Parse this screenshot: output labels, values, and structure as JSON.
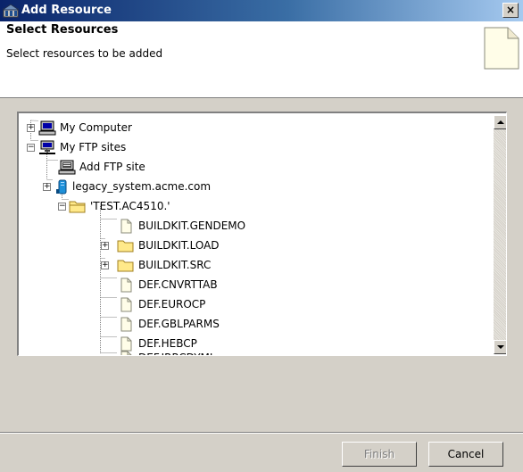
{
  "window": {
    "title": "Add Resource",
    "close_label": "×"
  },
  "header": {
    "title": "Select Resources",
    "description": "Select resources to be added"
  },
  "tree": {
    "items": [
      {
        "label": "My Computer",
        "icon": "computer-icon",
        "expander": "+"
      },
      {
        "label": "My FTP sites",
        "icon": "network-computer-icon",
        "expander": "−"
      },
      {
        "label": "Add FTP site",
        "icon": "add-ftp-site-icon"
      },
      {
        "label": "legacy_system.acme.com",
        "icon": "server-icon",
        "expander": "+"
      },
      {
        "label": "'TEST.AC4510.'",
        "icon": "folder-open-icon",
        "expander": "−"
      },
      {
        "label": "BUILDKIT.GENDEMO",
        "icon": "file-icon"
      },
      {
        "label": "BUILDKIT.LOAD",
        "icon": "folder-icon",
        "expander": "+"
      },
      {
        "label": "BUILDKIT.SRC",
        "icon": "folder-icon",
        "expander": "+"
      },
      {
        "label": "DEF.CNVRTTAB",
        "icon": "file-icon"
      },
      {
        "label": "DEF.EUROCP",
        "icon": "file-icon"
      },
      {
        "label": "DEF.GBLPARMS",
        "icon": "file-icon"
      },
      {
        "label": "DEF.HEBCP",
        "icon": "file-icon"
      },
      {
        "label": "DEF.IRRCDYML",
        "icon": "file-icon"
      }
    ]
  },
  "buttons": {
    "finish": "Finish",
    "cancel": "Cancel"
  },
  "colors": {
    "title_start": "#0a246a",
    "title_end": "#a6caf0",
    "folder": "#ffe98a",
    "dialog": "#d4d0c8"
  }
}
